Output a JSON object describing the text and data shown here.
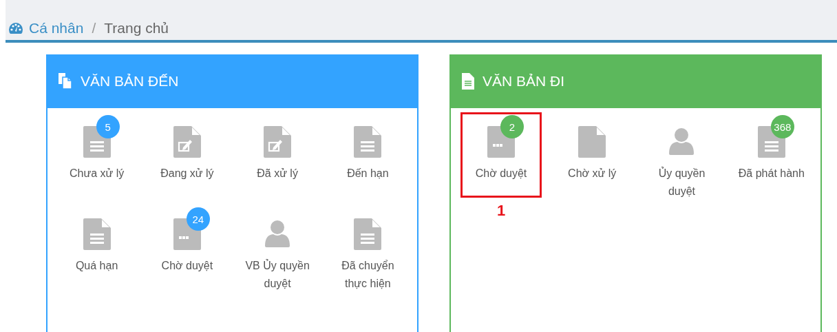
{
  "breadcrumb": {
    "items": [
      {
        "label": "Cá nhân",
        "selected": false
      },
      {
        "label": "Trang chủ",
        "selected": true
      }
    ],
    "separator": "/"
  },
  "panels": [
    {
      "title": "VĂN BẢN ĐẾN",
      "color": "#33a3ff",
      "kind": "copy",
      "items": [
        {
          "kind": "lines",
          "label": "Chưa xử lý",
          "badge": "5",
          "highlighted": false
        },
        {
          "kind": "edit",
          "label": "Đang xử lý",
          "highlighted": false
        },
        {
          "kind": "edit",
          "label": "Đã xử lý",
          "highlighted": false
        },
        {
          "kind": "lines",
          "label": "Đến hạn",
          "highlighted": false
        },
        {
          "kind": "lines",
          "label": "Quá hạn",
          "highlighted": false
        },
        {
          "kind": "dots",
          "label": "Chờ duyệt",
          "badge": "24",
          "highlighted": false
        },
        {
          "kind": "person",
          "label": "VB Ủy quyền duyệt",
          "highlighted": false
        },
        {
          "kind": "lines",
          "label": "Đã chuyển thực hiện",
          "highlighted": false
        }
      ]
    },
    {
      "title": "VĂN BẢN ĐI",
      "color": "#5cb85c",
      "kind": "doc",
      "items": [
        {
          "kind": "dots",
          "label": "Chờ duyệt",
          "badge": "2",
          "highlighted": true,
          "annotation": "1"
        },
        {
          "kind": "blank",
          "label": "Chờ xử lý",
          "highlighted": false
        },
        {
          "kind": "person",
          "label": "Ủy quyền duyệt",
          "highlighted": false
        },
        {
          "kind": "lines",
          "label": "Đã phát hành",
          "badge": "368",
          "highlighted": false
        }
      ]
    }
  ]
}
